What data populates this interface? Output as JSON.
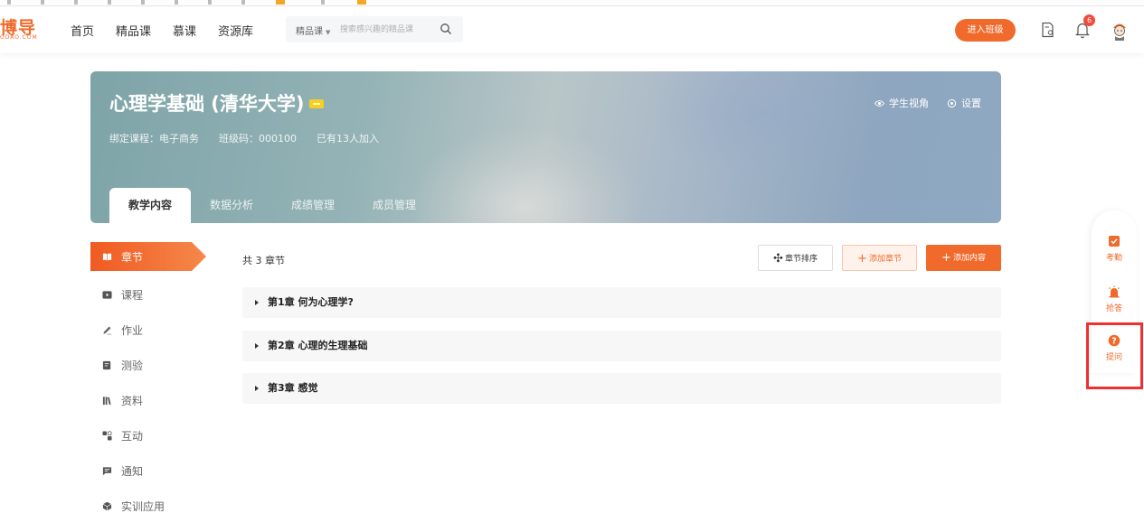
{
  "header": {
    "logo_text": "博导",
    "logo_subtext": "ODAO.COM",
    "nav": [
      "首页",
      "精品课",
      "慕课",
      "资源库"
    ],
    "search": {
      "category": "精品课",
      "placeholder": "搜索感兴趣的精品课"
    },
    "enter_class_label": "进入班级",
    "notification_count": "6"
  },
  "course": {
    "title": "心理学基础 (清华大学)",
    "bound_course": "绑定课程：电子商务",
    "class_code": "班级码：000100",
    "joined": "已有13人加入",
    "student_view_label": "学生视角",
    "settings_label": "设置",
    "tabs": [
      "教学内容",
      "数据分析",
      "成绩管理",
      "成员管理"
    ]
  },
  "sidebar": {
    "items": [
      {
        "label": "章节",
        "icon": "book-icon",
        "active": true
      },
      {
        "label": "课程",
        "icon": "video-icon"
      },
      {
        "label": "作业",
        "icon": "pen-icon"
      },
      {
        "label": "测验",
        "icon": "quiz-icon"
      },
      {
        "label": "资料",
        "icon": "library-icon"
      },
      {
        "label": "互动",
        "icon": "interact-icon"
      },
      {
        "label": "通知",
        "icon": "message-icon"
      },
      {
        "label": "实训应用",
        "icon": "cube-icon"
      }
    ]
  },
  "content": {
    "chapter_count": "共 3 章节",
    "sort_label": "章节排序",
    "add_chapter_label": "添加章节",
    "add_content_label": "添加内容",
    "chapters": [
      "第1章 何为心理学?",
      "第2章 心理的生理基础",
      "第3章 感觉"
    ]
  },
  "float_tools": {
    "attendance_label": "考勤",
    "quick_answer_label": "抢答",
    "question_label": "提问"
  },
  "colors": {
    "accent": "#f06a2c",
    "highlight": "#ee3030"
  }
}
